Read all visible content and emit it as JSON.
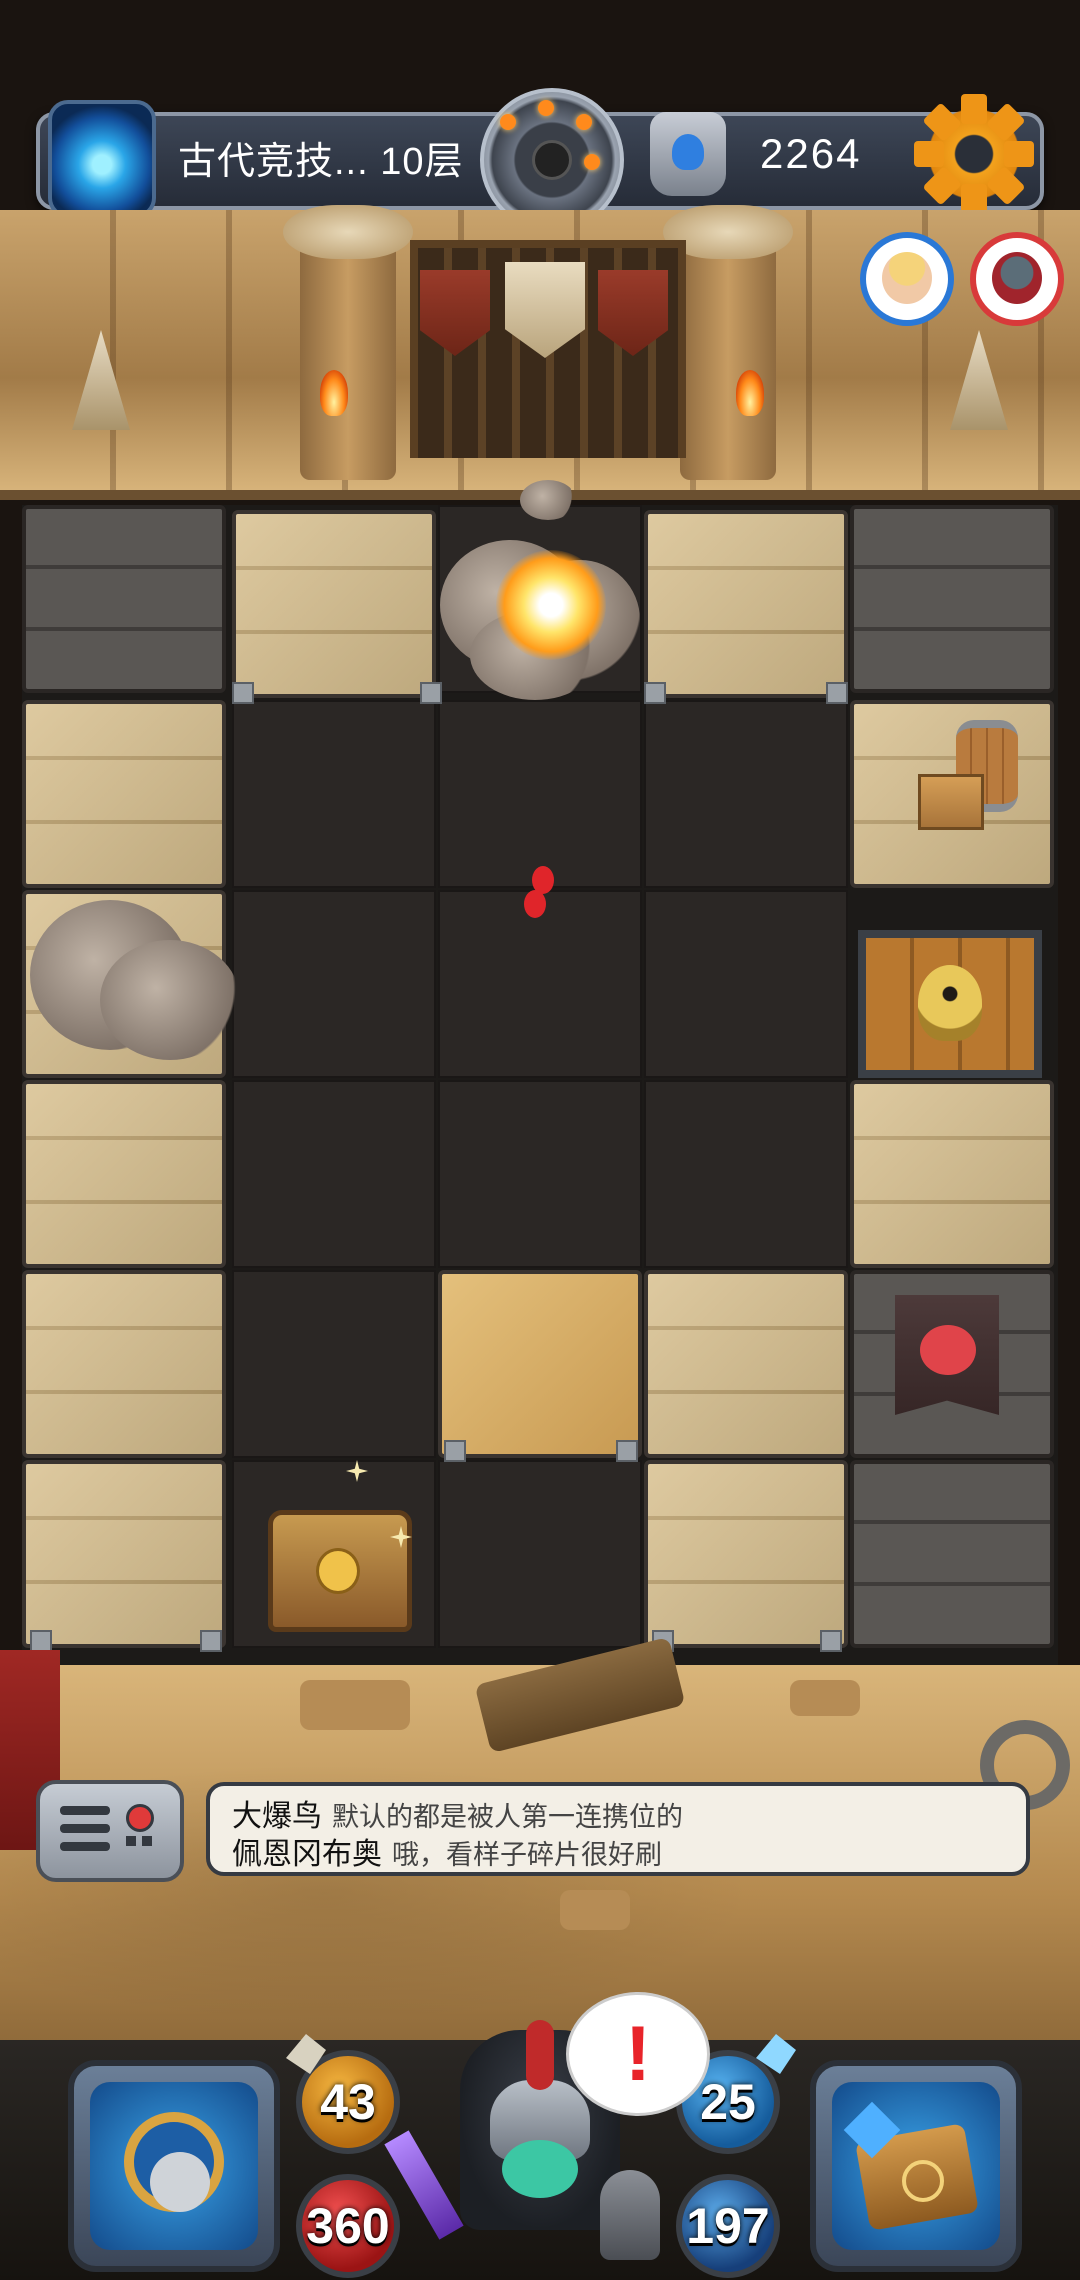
{
  "topbar": {
    "level_name": "古代竞技... 10层",
    "gold": "2264",
    "icons": {
      "portal": "portal-icon",
      "center": "bomb-medal-icon",
      "rune": "rune-stone-icon",
      "settings": "gear-icon"
    }
  },
  "allies": [
    {
      "name": "ally-avatar-blonde",
      "ring_color": "#2a78d6"
    },
    {
      "name": "ally-avatar-dark",
      "ring_color": "#d83a3a"
    }
  ],
  "chat": {
    "lines": [
      {
        "speaker": "大爆鸟",
        "text": "默认的都是被人第一连携位的"
      },
      {
        "speaker": "佩恩冈布奥",
        "text": "哦，看样子碎片很好刷"
      }
    ]
  },
  "stats": {
    "attack": "43",
    "hp": "360",
    "defense": "25",
    "mp": "197"
  },
  "hero_alert": "!",
  "colors": {
    "gold": "#f3a21d",
    "hp": "#d32828",
    "mana": "#2a78d6"
  }
}
